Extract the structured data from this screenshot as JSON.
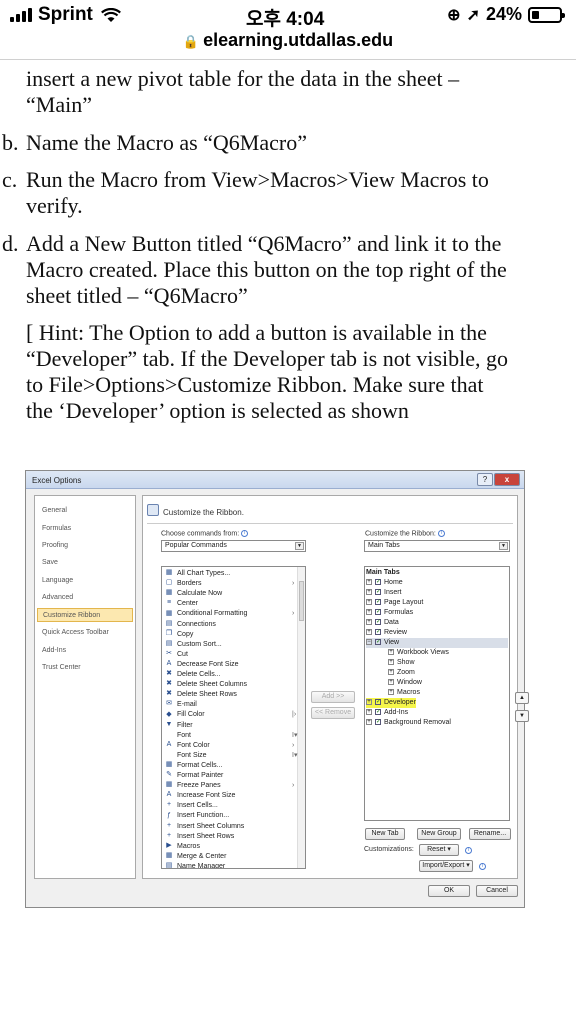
{
  "status": {
    "carrier": "Sprint",
    "time": "오후 4:04",
    "battery": "24%"
  },
  "url": "elearning.utdallas.edu",
  "doc": {
    "top_lines": [
      "insert a new pivot table for the data in the sheet –",
      "“Main”"
    ],
    "b_marker": "b.",
    "b": "Name the Macro as “Q6Macro”",
    "c_marker": "c.",
    "c_lines": [
      "Run the Macro from View>Macros>View Macros to",
      "verify."
    ],
    "d_marker": "d.",
    "d_lines": [
      "Add a New Button titled “Q6Macro” and link it to the",
      "Macro created. Place this button on the top right of the",
      "sheet titled – “Q6Macro”"
    ],
    "hint_lines": [
      "[ Hint: The Option to add a button is available in the",
      "“Developer” tab. If the Developer tab is not visible, go",
      "to File>Options>Customize Ribbon. Make sure that",
      "the ‘Developer’ option is selected as shown"
    ]
  },
  "dialog": {
    "title": "Excel Options",
    "help": "?",
    "close": "x",
    "nav": [
      "General",
      "Formulas",
      "Proofing",
      "Save",
      "Language",
      "Advanced",
      "Customize Ribbon",
      "Quick Access Toolbar",
      "Add-Ins",
      "Trust Center"
    ],
    "header": "Customize the Ribbon.",
    "choose_label": "Choose commands from:",
    "choose_value": "Popular Commands",
    "customize_label": "Customize the Ribbon:",
    "customize_value": "Main Tabs",
    "commands": [
      {
        "icon": "▦",
        "label": "All Chart Types..."
      },
      {
        "icon": "▢",
        "label": "Borders",
        "arrow": "›"
      },
      {
        "icon": "▦",
        "label": "Calculate Now"
      },
      {
        "icon": "≡",
        "label": "Center"
      },
      {
        "icon": "▦",
        "label": "Conditional Formatting",
        "arrow": "›"
      },
      {
        "icon": "▤",
        "label": "Connections"
      },
      {
        "icon": "❐",
        "label": "Copy"
      },
      {
        "icon": "▤",
        "label": "Custom Sort..."
      },
      {
        "icon": "✂",
        "label": "Cut"
      },
      {
        "icon": "A",
        "label": "Decrease Font Size"
      },
      {
        "icon": "✖",
        "label": "Delete Cells..."
      },
      {
        "icon": "✖",
        "label": "Delete Sheet Columns"
      },
      {
        "icon": "✖",
        "label": "Delete Sheet Rows"
      },
      {
        "icon": "✉",
        "label": "E-mail"
      },
      {
        "icon": "◆",
        "label": "Fill Color",
        "arrow": "|›"
      },
      {
        "icon": "▼",
        "label": "Filter"
      },
      {
        "icon": "",
        "label": "Font",
        "arrow": "I▾"
      },
      {
        "icon": "A",
        "label": "Font Color",
        "arrow": "›"
      },
      {
        "icon": "",
        "label": "Font Size",
        "arrow": "I▾"
      },
      {
        "icon": "▦",
        "label": "Format Cells..."
      },
      {
        "icon": "✎",
        "label": "Format Painter"
      },
      {
        "icon": "▦",
        "label": "Freeze Panes",
        "arrow": "›"
      },
      {
        "icon": "A",
        "label": "Increase Font Size"
      },
      {
        "icon": "+",
        "label": "Insert Cells..."
      },
      {
        "icon": "ƒ",
        "label": "Insert Function..."
      },
      {
        "icon": "+",
        "label": "Insert Sheet Columns"
      },
      {
        "icon": "+",
        "label": "Insert Sheet Rows"
      },
      {
        "icon": "▶",
        "label": "Macros"
      },
      {
        "icon": "▦",
        "label": "Merge & Center"
      },
      {
        "icon": "▤",
        "label": "Name Manager"
      }
    ],
    "tabs_title": "Main Tabs",
    "tabs": [
      {
        "label": "Home",
        "level": 0,
        "check": true,
        "expand": "+"
      },
      {
        "label": "Insert",
        "level": 0,
        "check": true,
        "expand": "+"
      },
      {
        "label": "Page Layout",
        "level": 0,
        "check": true,
        "expand": "+"
      },
      {
        "label": "Formulas",
        "level": 0,
        "check": true,
        "expand": "+"
      },
      {
        "label": "Data",
        "level": 0,
        "check": true,
        "expand": "+"
      },
      {
        "label": "Review",
        "level": 0,
        "check": true,
        "expand": "+"
      },
      {
        "label": "View",
        "level": 0,
        "check": true,
        "expand": "−",
        "selected": true
      },
      {
        "label": "Workbook Views",
        "level": 1,
        "expand": "+"
      },
      {
        "label": "Show",
        "level": 1,
        "expand": "+"
      },
      {
        "label": "Zoom",
        "level": 1,
        "expand": "+"
      },
      {
        "label": "Window",
        "level": 1,
        "expand": "+"
      },
      {
        "label": "Macros",
        "level": 1,
        "expand": "+"
      },
      {
        "label": "Developer",
        "level": 0,
        "check": true,
        "expand": "+",
        "highlight": true
      },
      {
        "label": "Add-Ins",
        "level": 0,
        "check": true,
        "expand": "+"
      },
      {
        "label": "Background Removal",
        "level": 0,
        "check": true,
        "expand": "+"
      }
    ],
    "add_button": "Add >>",
    "remove_button": "<< Remove",
    "new_tab": "New Tab",
    "new_group": "New Group",
    "rename": "Rename...",
    "customizations_label": "Customizations:",
    "reset": "Reset ▾",
    "import_export": "Import/Export ▾",
    "ok": "OK",
    "cancel": "Cancel",
    "highlight_color": "#f5f54a"
  }
}
